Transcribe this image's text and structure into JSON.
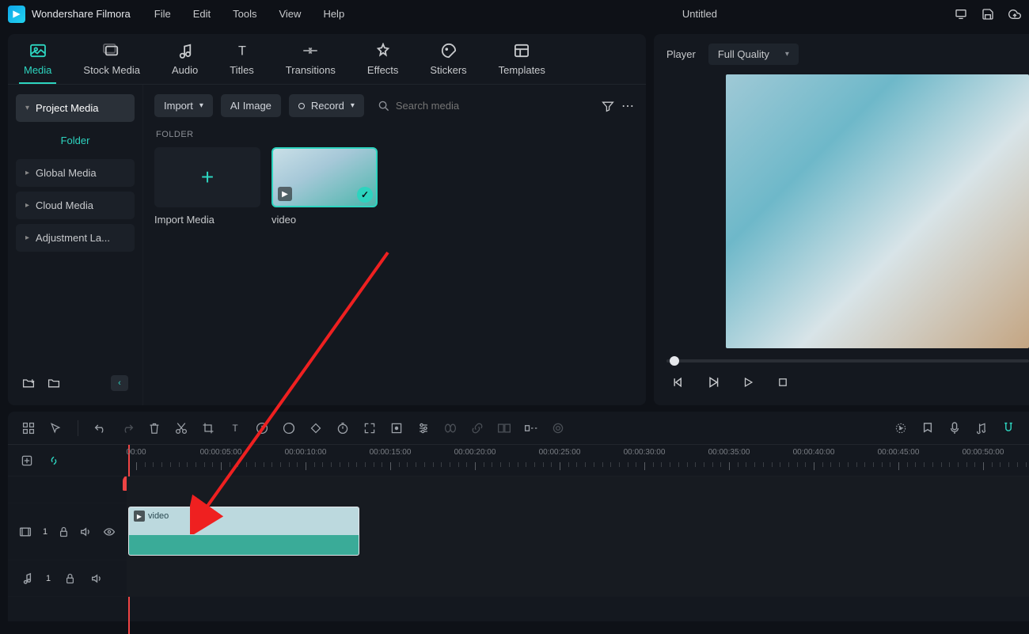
{
  "titlebar": {
    "app_name": "Wondershare Filmora",
    "menu": [
      "File",
      "Edit",
      "Tools",
      "View",
      "Help"
    ],
    "project_title": "Untitled"
  },
  "tabs": [
    {
      "label": "Media",
      "active": true
    },
    {
      "label": "Stock Media"
    },
    {
      "label": "Audio"
    },
    {
      "label": "Titles"
    },
    {
      "label": "Transitions"
    },
    {
      "label": "Effects"
    },
    {
      "label": "Stickers"
    },
    {
      "label": "Templates"
    }
  ],
  "sidebar": {
    "project_media": "Project Media",
    "folder": "Folder",
    "global_media": "Global Media",
    "cloud_media": "Cloud Media",
    "adjustment_layer": "Adjustment La..."
  },
  "toolbar": {
    "import": "Import",
    "ai_image": "AI Image",
    "record": "Record",
    "search_placeholder": "Search media"
  },
  "content": {
    "section_label": "FOLDER",
    "import_media": "Import Media",
    "video_name": "video"
  },
  "player": {
    "label": "Player",
    "quality": "Full Quality"
  },
  "timeline": {
    "ticks": [
      "00:00",
      "00:00:05:00",
      "00:00:10:00",
      "00:00:15:00",
      "00:00:20:00",
      "00:00:25:00",
      "00:00:30:00",
      "00:00:35:00",
      "00:00:40:00",
      "00:00:45:00",
      "00:00:50:00"
    ],
    "clip_name": "video",
    "video_track_num": "1",
    "audio_track_num": "1"
  }
}
